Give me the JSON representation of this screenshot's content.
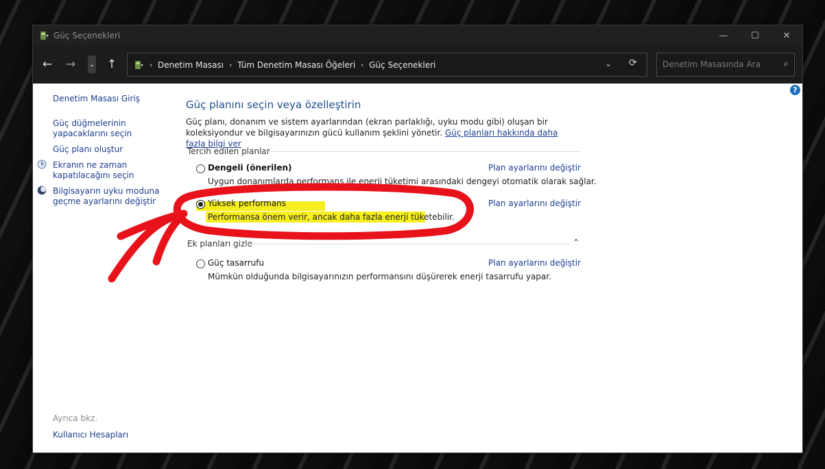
{
  "window": {
    "title": "Güç Seçenekleri",
    "controls": {
      "minimize": "—",
      "maximize": "☐",
      "close": "✕"
    }
  },
  "navigation": {
    "back": "←",
    "forward": "→",
    "recent": "⌄",
    "up": "↑",
    "breadcrumbs": [
      "Denetim Masası",
      "Tüm Denetim Masası Öğeleri",
      "Güç Seçenekleri"
    ],
    "breadcrumb_separator": "›",
    "dropdown": "⌄",
    "refresh": "⟳"
  },
  "search": {
    "placeholder": "Denetim Masasında Ara",
    "icon": "⌕"
  },
  "help": {
    "label": "?"
  },
  "sidebar": {
    "items": [
      {
        "label": "Denetim Masası Giriş"
      },
      {
        "label": "Güç düğmelerinin\nyapacaklarını seçin"
      },
      {
        "label": "Güç planı oluştur"
      },
      {
        "label": "Ekranın ne zaman\nkapatılacağını seçin"
      },
      {
        "label": "Bilgisayarın uyku moduna\ngeçme ayarlarını değiştir"
      }
    ],
    "see_also_heading": "Ayrıca bkz.",
    "see_also_items": [
      {
        "label": "Kullanıcı Hesapları"
      }
    ]
  },
  "main": {
    "title": "Güç planını seçin veya özelleştirin",
    "description": "Güç planı, donanım ve sistem ayarlarından (ekran parlaklığı, uyku modu gibi) oluşan bir koleksiyondur ve bilgisayarınızın gücü kullanım şeklini yönetir.",
    "description_link": "Güç planları hakkında daha fazla bilgi ver",
    "preferred_heading": "Tercih edilen planlar",
    "hidden_heading": "Ek planları gizle",
    "hidden_toggle": "⌃",
    "change_settings_label": "Plan ayarlarını değiştir",
    "plans": [
      {
        "name": "Dengeli (önerilen)",
        "description": "Uygun donanımlarda performans ile enerji tüketimi arasındaki dengeyi otomatik olarak sağlar.",
        "selected": false
      },
      {
        "name": "Yüksek performans",
        "description": "Performansa önem verir, ancak daha fazla enerji tüketebilir.",
        "selected": true
      },
      {
        "name": "Güç tasarrufu",
        "description": "Mümkün olduğunda bilgisayarınızın performansını düşürerek enerji tasarrufu yapar.",
        "selected": false
      }
    ]
  },
  "annotation": {
    "color": "#e8121b",
    "highlight_color": "#f6ee1e"
  }
}
